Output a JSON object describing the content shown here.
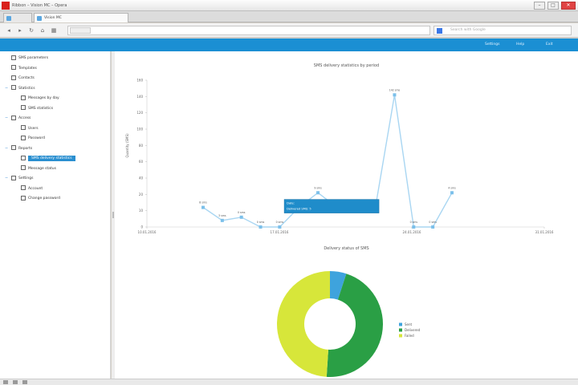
{
  "window": {
    "title": "Ribbon – Vision MC – Opera",
    "minimize": "–",
    "maximize": "□",
    "close": "✕"
  },
  "tabs": [
    {
      "label": ""
    },
    {
      "label": "Vision MC"
    }
  ],
  "address": {
    "url": "",
    "search_placeholder": "Search with Google"
  },
  "appbar": {
    "links": [
      "Settings",
      "Help",
      "Exit"
    ]
  },
  "sidebar": {
    "items": [
      {
        "label": "SMS parameters",
        "indent": 0
      },
      {
        "label": "Templates",
        "indent": 0
      },
      {
        "label": "Contacts",
        "indent": 0
      },
      {
        "label": "Statistics",
        "indent": 0,
        "expander": "−"
      },
      {
        "label": "Messages by day",
        "indent": 1
      },
      {
        "label": "SMS statistics",
        "indent": 1
      },
      {
        "label": "Access",
        "indent": 0,
        "expander": "−"
      },
      {
        "label": "Users",
        "indent": 1
      },
      {
        "label": "Password",
        "indent": 1
      },
      {
        "label": "Reports",
        "indent": 0,
        "expander": "−"
      },
      {
        "label": "SMS delivery statistics",
        "indent": 1,
        "selected": true
      },
      {
        "label": "Message status",
        "indent": 1
      },
      {
        "label": "Settings",
        "indent": 0,
        "expander": "−"
      },
      {
        "label": "Account",
        "indent": 1
      },
      {
        "label": "Change password",
        "indent": 1
      }
    ]
  },
  "chart_data": [
    {
      "type": "line",
      "title": "SMS delivery statistics by period",
      "ylabel": "Quantity (SMS)",
      "xlabel": "",
      "ylim": [
        0,
        160
      ],
      "yticks": [
        0,
        10,
        20,
        40,
        60,
        80,
        100,
        120,
        140,
        160
      ],
      "xticks": [
        "10.01.2016",
        "17.01.2016",
        "24.01.2016",
        "31.01.2016"
      ],
      "color": "#a9d6f2",
      "points": [
        {
          "label": "8 sms",
          "y": 12
        },
        {
          "label": "3 sms",
          "y": 4
        },
        {
          "label": "0 sms",
          "y": 6
        },
        {
          "label": "0 sms",
          "y": 0
        },
        {
          "label": "0 sms",
          "y": 0
        },
        {
          "label": "0 sms",
          "y": 12
        },
        {
          "label": "9 sms",
          "y": 22
        },
        {
          "label": "11 sms",
          "y": 12
        },
        {
          "label": "5 sms",
          "y": 12
        },
        {
          "label": "0 sms",
          "y": 12
        },
        {
          "label": "142 sms",
          "y": 142
        },
        {
          "label": "0 sms",
          "y": 0
        },
        {
          "label": "0 sms",
          "y": 0
        },
        {
          "label": "4 sms",
          "y": 22
        }
      ],
      "tooltip": {
        "title": "Date:",
        "value": "Delivered SMS: 5"
      }
    },
    {
      "type": "pie",
      "title": "Delivery status of SMS",
      "legend_position": "right",
      "slices": [
        {
          "name": "Sent",
          "value": 5,
          "color": "#3ea3dd"
        },
        {
          "name": "Delivered",
          "value": 46,
          "color": "#2a9f45"
        },
        {
          "name": "Failed",
          "value": 49,
          "color": "#d7e63a"
        }
      ]
    }
  ]
}
